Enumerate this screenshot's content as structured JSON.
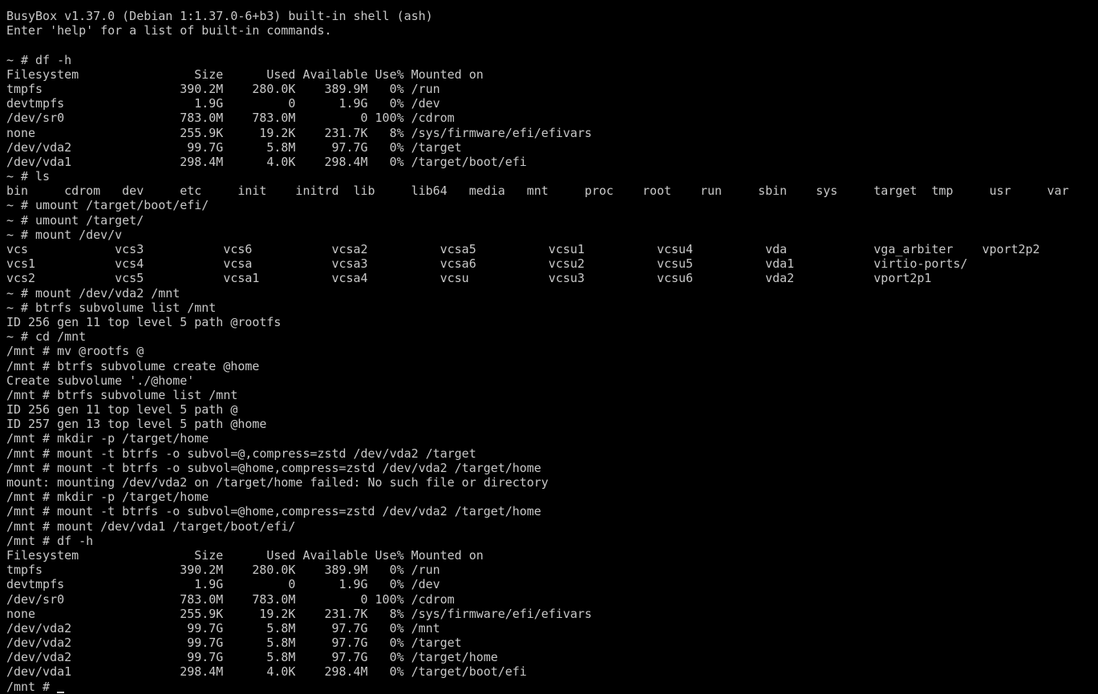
{
  "colors": {
    "background": "#000000",
    "foreground": "#c8c8c8"
  },
  "terminal": {
    "lines": [
      "BusyBox v1.37.0 (Debian 1:1.37.0-6+b3) built-in shell (ash)",
      "Enter 'help' for a list of built-in commands.",
      "",
      "~ # df -h",
      "Filesystem                Size      Used Available Use% Mounted on",
      "tmpfs                   390.2M    280.0K    389.9M   0% /run",
      "devtmpfs                  1.9G         0      1.9G   0% /dev",
      "/dev/sr0                783.0M    783.0M         0 100% /cdrom",
      "none                    255.9K     19.2K    231.7K   8% /sys/firmware/efi/efivars",
      "/dev/vda2                99.7G      5.8M     97.7G   0% /target",
      "/dev/vda1               298.4M      4.0K    298.4M   0% /target/boot/efi",
      "~ # ls",
      "bin     cdrom   dev     etc     init    initrd  lib     lib64   media   mnt     proc    root    run     sbin    sys     target  tmp     usr     var",
      "~ # umount /target/boot/efi/",
      "~ # umount /target/",
      "~ # mount /dev/v",
      "vcs            vcs3           vcs6           vcsa2          vcsa5          vcsu1          vcsu4          vda            vga_arbiter    vport2p2",
      "vcs1           vcs4           vcsa           vcsa3          vcsa6          vcsu2          vcsu5          vda1           virtio-ports/",
      "vcs2           vcs5           vcsa1          vcsa4          vcsu           vcsu3          vcsu6          vda2           vport2p1",
      "~ # mount /dev/vda2 /mnt",
      "~ # btrfs subvolume list /mnt",
      "ID 256 gen 11 top level 5 path @rootfs",
      "~ # cd /mnt",
      "/mnt # mv @rootfs @",
      "/mnt # btrfs subvolume create @home",
      "Create subvolume './@home'",
      "/mnt # btrfs subvolume list /mnt",
      "ID 256 gen 11 top level 5 path @",
      "ID 257 gen 13 top level 5 path @home",
      "/mnt # mkdir -p /target/home",
      "/mnt # mount -t btrfs -o subvol=@,compress=zstd /dev/vda2 /target",
      "/mnt # mount -t btrfs -o subvol=@home,compress=zstd /dev/vda2 /target/home",
      "mount: mounting /dev/vda2 on /target/home failed: No such file or directory",
      "/mnt # mkdir -p /target/home",
      "/mnt # mount -t btrfs -o subvol=@home,compress=zstd /dev/vda2 /target/home",
      "/mnt # mount /dev/vda1 /target/boot/efi/",
      "/mnt # df -h",
      "Filesystem                Size      Used Available Use% Mounted on",
      "tmpfs                   390.2M    280.0K    389.9M   0% /run",
      "devtmpfs                  1.9G         0      1.9G   0% /dev",
      "/dev/sr0                783.0M    783.0M         0 100% /cdrom",
      "none                    255.9K     19.2K    231.7K   8% /sys/firmware/efi/efivars",
      "/dev/vda2                99.7G      5.8M     97.7G   0% /mnt",
      "/dev/vda2                99.7G      5.8M     97.7G   0% /target",
      "/dev/vda2                99.7G      5.8M     97.7G   0% /target/home",
      "/dev/vda1               298.4M      4.0K    298.4M   0% /target/boot/efi"
    ],
    "prompt": "/mnt # "
  }
}
